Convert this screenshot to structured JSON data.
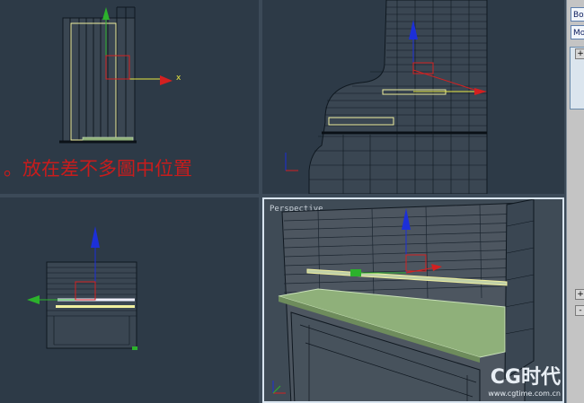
{
  "viewports": {
    "perspective_label": "Perspective"
  },
  "annotation": "。放在差不多圖中位置",
  "gizmo": {
    "x_label": "x"
  },
  "panel": {
    "field1": "Box",
    "field2": "Mo",
    "plus": "+",
    "minus": "-"
  },
  "watermark": {
    "logo_text": "CG时代",
    "url": "www.cgtime.com.cn"
  },
  "colors": {
    "viewport_bg": "#2d3a47",
    "annotation": "#c81c1c",
    "axis_x": "#d32020",
    "axis_y": "#1c2fd8",
    "axis_z": "#2cb22c",
    "selection": "#f0f0a0",
    "keyboard": "#8fb07a"
  }
}
